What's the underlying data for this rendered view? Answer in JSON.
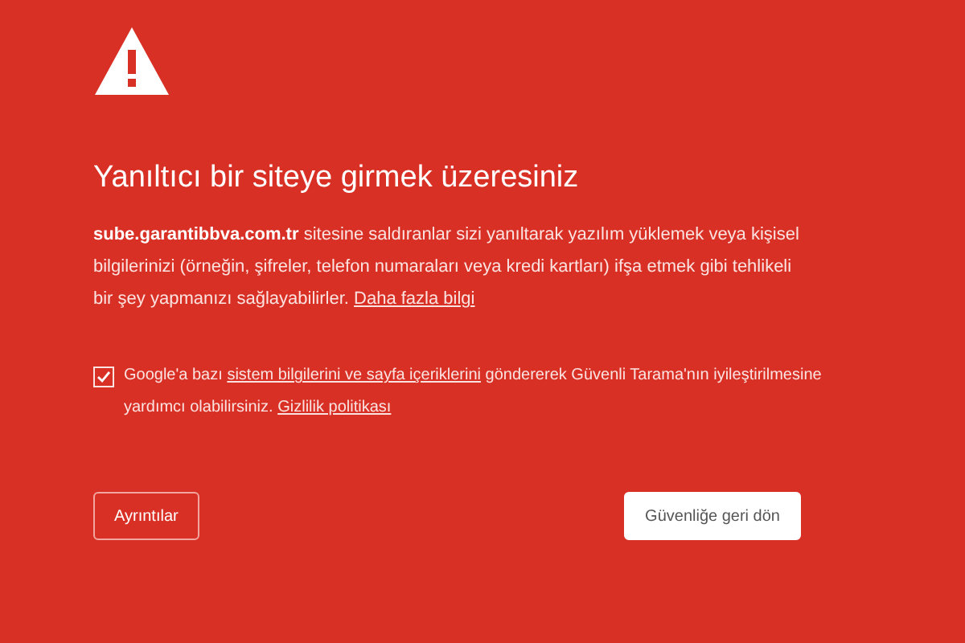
{
  "heading": "Yanıltıcı bir siteye girmek üzeresiniz",
  "message": [
    {
      "kind": "bold",
      "text": "sube.garantibbva.com.tr"
    },
    {
      "kind": "text",
      "text": " sitesine saldıranlar sizi yanıltarak yazılım yüklemek veya kişisel bilgilerinizi (örneğin, şifreler, telefon numaraları veya kredi kartları) ifşa etmek gibi tehlikeli bir şey yapmanızı sağlayabilirler. "
    },
    {
      "kind": "link",
      "text": "Daha fazla bilgi"
    }
  ],
  "report": {
    "checked": true,
    "parts": [
      {
        "kind": "text",
        "text": "Google'a bazı "
      },
      {
        "kind": "link",
        "text": "sistem bilgilerini ve sayfa içeriklerini"
      },
      {
        "kind": "text",
        "text": " göndererek Güvenli Tarama'nın iyileştirilmesine yardımcı olabilirsiniz. "
      },
      {
        "kind": "link",
        "text": "Gizlilik politikası"
      }
    ]
  },
  "buttons": [
    {
      "kind": "outline",
      "label": "Ayrıntılar"
    },
    {
      "kind": "primary",
      "label": "Güvenliğe geri dön"
    }
  ]
}
